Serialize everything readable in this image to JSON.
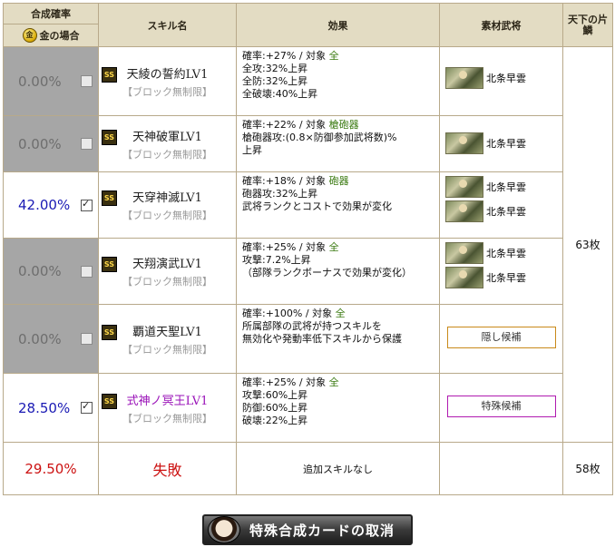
{
  "header": {
    "rate_title": "合成確率",
    "rate_sub": "金の場合",
    "skill_col": "スキル名",
    "effect_col": "効果",
    "material_col": "素材武将",
    "fragment_col": "天下の片鱗"
  },
  "rows": [
    {
      "rate": "0.00%",
      "checked": false,
      "skill_name": "天綾の誓約LV1",
      "skill_sub": "【ブロック無制限】",
      "effect_line1": "確率:+27%",
      "effect_sep": "/",
      "effect_target_label": "対象",
      "effect_target": "全",
      "effect_lines": [
        "全攻:32%上昇",
        "全防:32%上昇",
        "全破壊:40%上昇"
      ],
      "materials": [
        "北条早雲"
      ]
    },
    {
      "rate": "0.00%",
      "checked": false,
      "skill_name": "天神破軍LV1",
      "skill_sub": "【ブロック無制限】",
      "effect_line1": "確率:+22%",
      "effect_sep": "/",
      "effect_target_label": "対象",
      "effect_target": "槍砲器",
      "effect_lines": [
        "槍砲器攻:(0.8×防御参加武将数)%",
        "上昇"
      ],
      "materials": [
        "北条早雲"
      ]
    },
    {
      "rate": "42.00%",
      "checked": true,
      "skill_name": "天穿神滅LV1",
      "skill_sub": "【ブロック無制限】",
      "effect_line1": "確率:+18%",
      "effect_sep": "/",
      "effect_target_label": "対象",
      "effect_target": "砲器",
      "effect_lines": [
        "砲器攻:32%上昇",
        "武将ランクとコストで効果が変化"
      ],
      "materials": [
        "北条早雲",
        "北条早雲"
      ]
    },
    {
      "rate": "0.00%",
      "checked": false,
      "skill_name": "天翔演武LV1",
      "skill_sub": "【ブロック無制限】",
      "effect_line1": "確率:+25%",
      "effect_sep": "/",
      "effect_target_label": "対象",
      "effect_target": "全",
      "effect_lines": [
        "攻撃:7.2%上昇",
        "（部隊ランクボーナスで効果が変化）"
      ],
      "materials": [
        "北条早雲",
        "北条早雲"
      ]
    },
    {
      "rate": "0.00%",
      "checked": false,
      "skill_name": "覇道天聖LV1",
      "skill_sub": "【ブロック無制限】",
      "effect_line1": "確率:+100%",
      "effect_sep": "/",
      "effect_target_label": "対象",
      "effect_target": "全",
      "effect_lines": [
        "所属部隊の武将が持つスキルを",
        "無効化や発動率低下スキルから保護"
      ],
      "candidate": "隠し候補"
    },
    {
      "rate": "28.50%",
      "checked": true,
      "skill_name": "式神ノ冥王LV1",
      "skill_sub": "【ブロック無制限】",
      "effect_line1": "確率:+25%",
      "effect_sep": "/",
      "effect_target_label": "対象",
      "effect_target": "全",
      "effect_lines": [
        "攻撃:60%上昇",
        "防御:60%上昇",
        "破壊:22%上昇"
      ],
      "candidate": "特殊候補"
    }
  ],
  "fail_row": {
    "rate": "29.50%",
    "label": "失敗",
    "message": "追加スキルなし",
    "fragments": "58枚"
  },
  "fragments_main": "63枚",
  "cancel_button": "特殊合成カードの取消"
}
